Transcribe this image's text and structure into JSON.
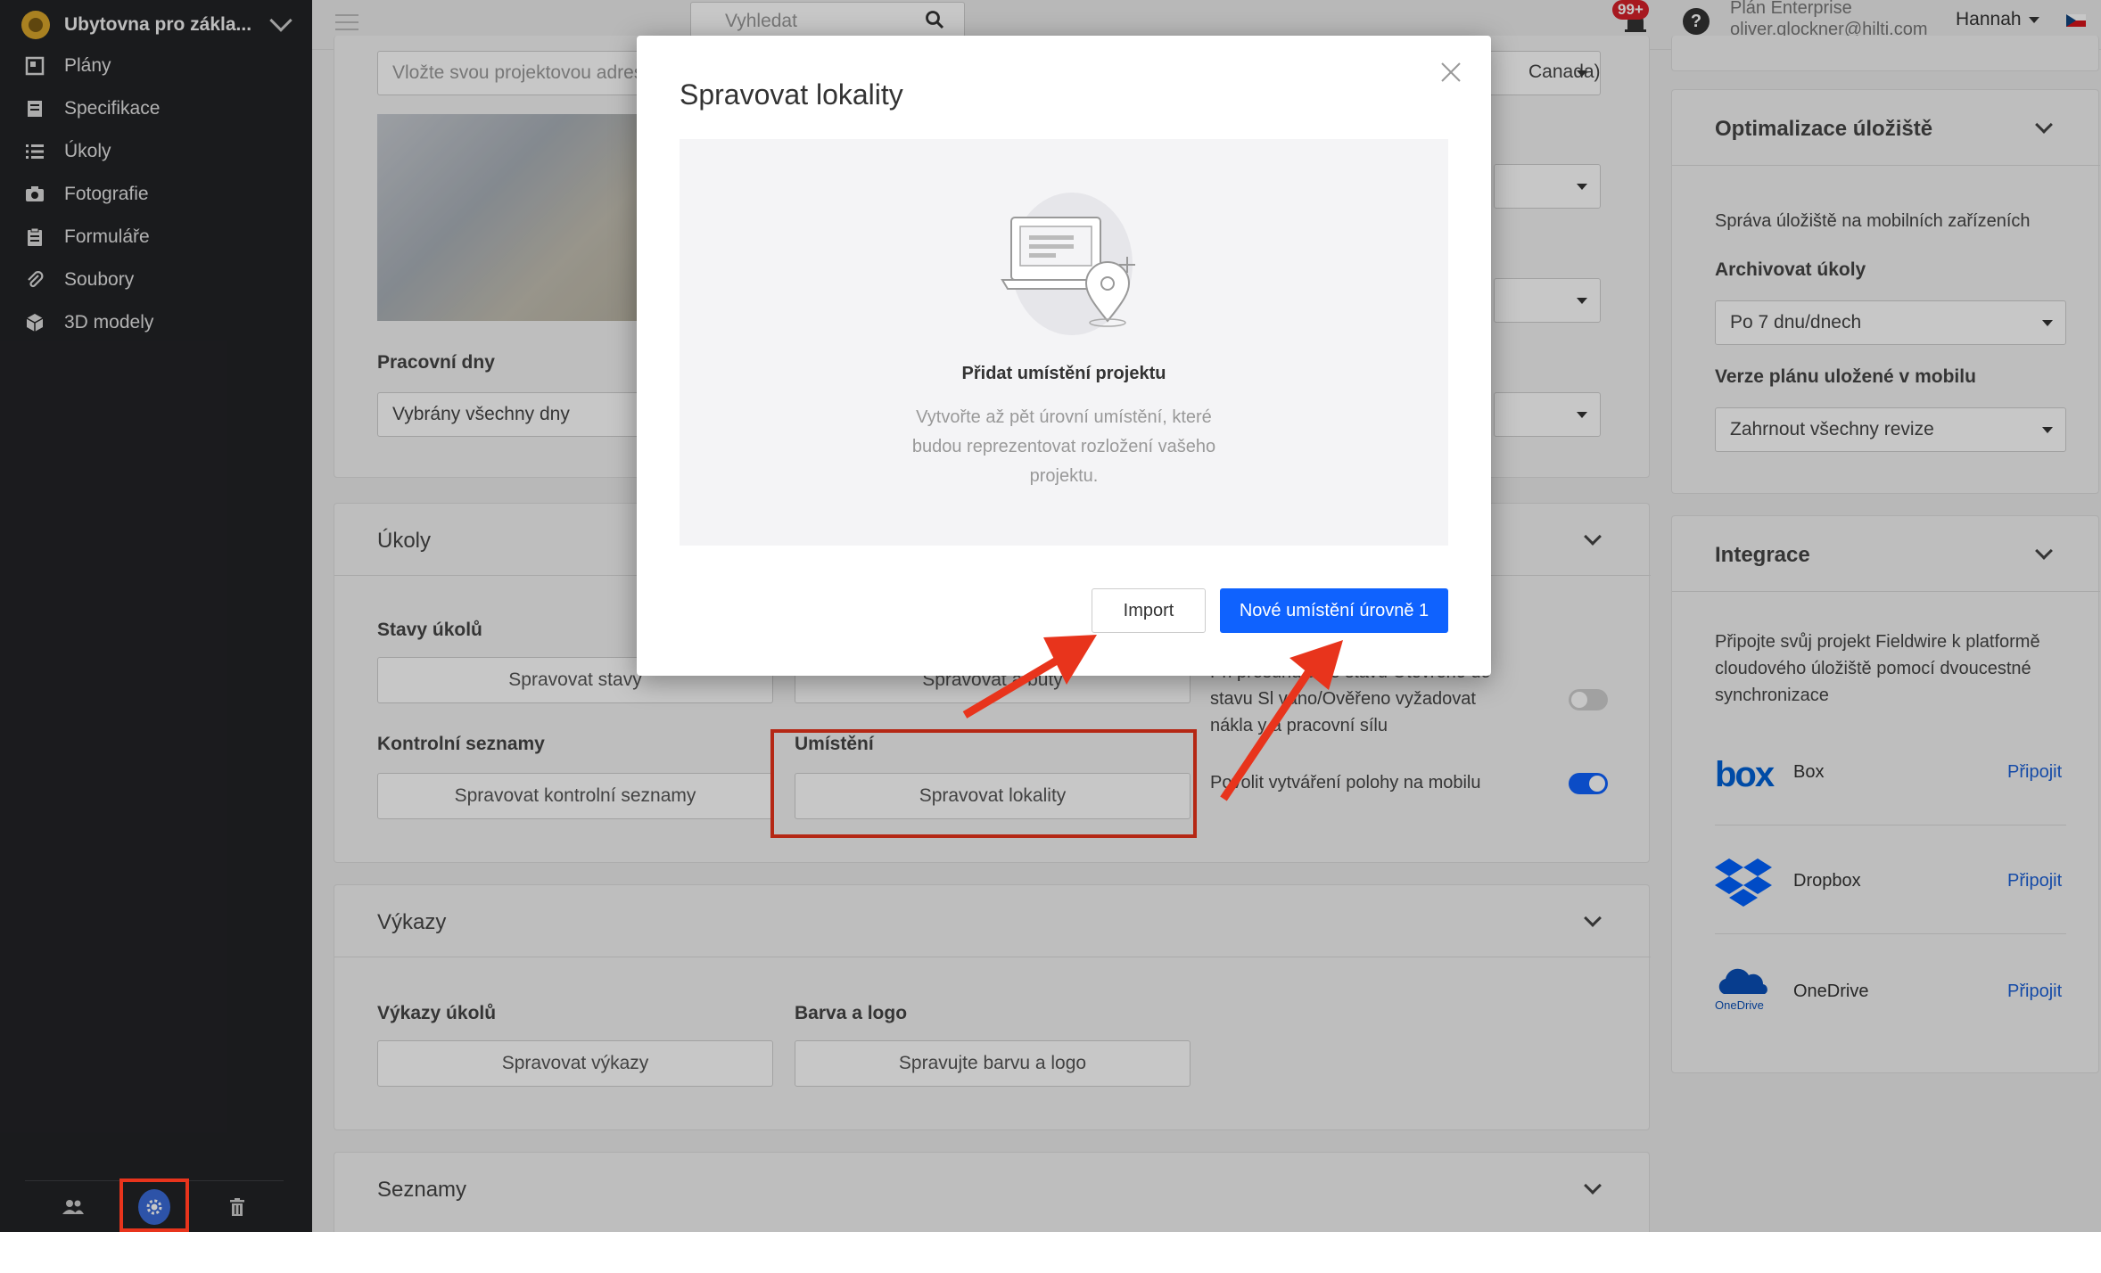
{
  "sidebar": {
    "project_name": "Ubytovna pro zákla...",
    "items": [
      {
        "label": "Plány",
        "icon": "plans-icon"
      },
      {
        "label": "Specifikace",
        "icon": "specifications-icon"
      },
      {
        "label": "Úkoly",
        "icon": "tasks-list-icon"
      },
      {
        "label": "Fotografie",
        "icon": "camera-icon"
      },
      {
        "label": "Formuláře",
        "icon": "forms-clipboard-icon"
      },
      {
        "label": "Soubory",
        "icon": "paperclip-icon"
      },
      {
        "label": "3D modely",
        "icon": "cube-icon"
      }
    ],
    "footer_icons": [
      "people-icon",
      "gear-icon",
      "trash-icon"
    ]
  },
  "topbar": {
    "search_placeholder": "Vyhledat",
    "notification_count": "99+",
    "plan_name": "Plán Enterprise",
    "user_email": "oliver.glockner@hilti.com",
    "user_name": "Hannah",
    "language_flag": "cz-flag-icon"
  },
  "settings": {
    "address_placeholder": "Vložte svou projektovou adres",
    "timezone_fragment": "Canada)",
    "working_days_label": "Pracovní dny",
    "working_days_value": "Vybrány všechny dny",
    "tasks_section": {
      "title": "Úkoly",
      "statuses_label": "Stavy úkolů",
      "statuses_button": "Spravovat stavy",
      "attributes_button_fragment": "Spravovat a      buty",
      "checklists_label": "Kontrolní seznamy",
      "checklists_button": "Spravovat kontrolní seznamy",
      "locations_label": "Umístění",
      "locations_button": "Spravovat lokality",
      "toggle1_text": [
        "Při přesunu      u ze stavu Otevřeno do",
        "stavu Sl      váno/Ověřeno vyžadovat",
        "nákla      y a pracovní sílu"
      ],
      "toggle1_on": false,
      "toggle2_text": "Povolit vytváření polohy na mobilu",
      "toggle2_on": true
    },
    "reports_section": {
      "title": "Výkazy",
      "task_reports_label": "Výkazy úkolů",
      "task_reports_button": "Spravovat výkazy",
      "color_logo_label": "Barva a logo",
      "color_logo_button": "Spravujte barvu a logo"
    },
    "lists_section": {
      "title": "Seznamy"
    }
  },
  "right_panel": {
    "storage": {
      "title": "Optimalizace úložiště",
      "subtitle": "Správa úložiště na mobilních zařízeních",
      "archive_label": "Archivovat úkoly",
      "archive_value": "Po 7 dnu/dnech",
      "plan_version_label": "Verze plánu uložené v mobilu",
      "plan_version_value": "Zahrnout všechny revize"
    },
    "integrations": {
      "title": "Integrace",
      "description": "Připojte svůj projekt Fieldwire k platformě cloudového úložiště pomocí dvoucestné synchronizace",
      "items": [
        {
          "name": "Box",
          "logo_text": "box",
          "action": "Připojit"
        },
        {
          "name": "Dropbox",
          "logo_text": "",
          "action": "Připojit"
        },
        {
          "name": "OneDrive",
          "logo_text": "OneDrive",
          "action": "Připojit"
        }
      ]
    }
  },
  "modal": {
    "title": "Spravovat lokality",
    "empty_heading": "Přidat umístění projektu",
    "empty_description": "Vytvořte až pět úrovní umístění, které budou reprezentovat rozložení vašeho projektu.",
    "import_button": "Import",
    "new_level_button": "Nové umístění úrovně 1"
  },
  "colors": {
    "sidebar_bg": "#222326",
    "primary_blue": "#0f62fe",
    "annotation_red": "#e8341c",
    "notification_red": "#d6202a"
  }
}
